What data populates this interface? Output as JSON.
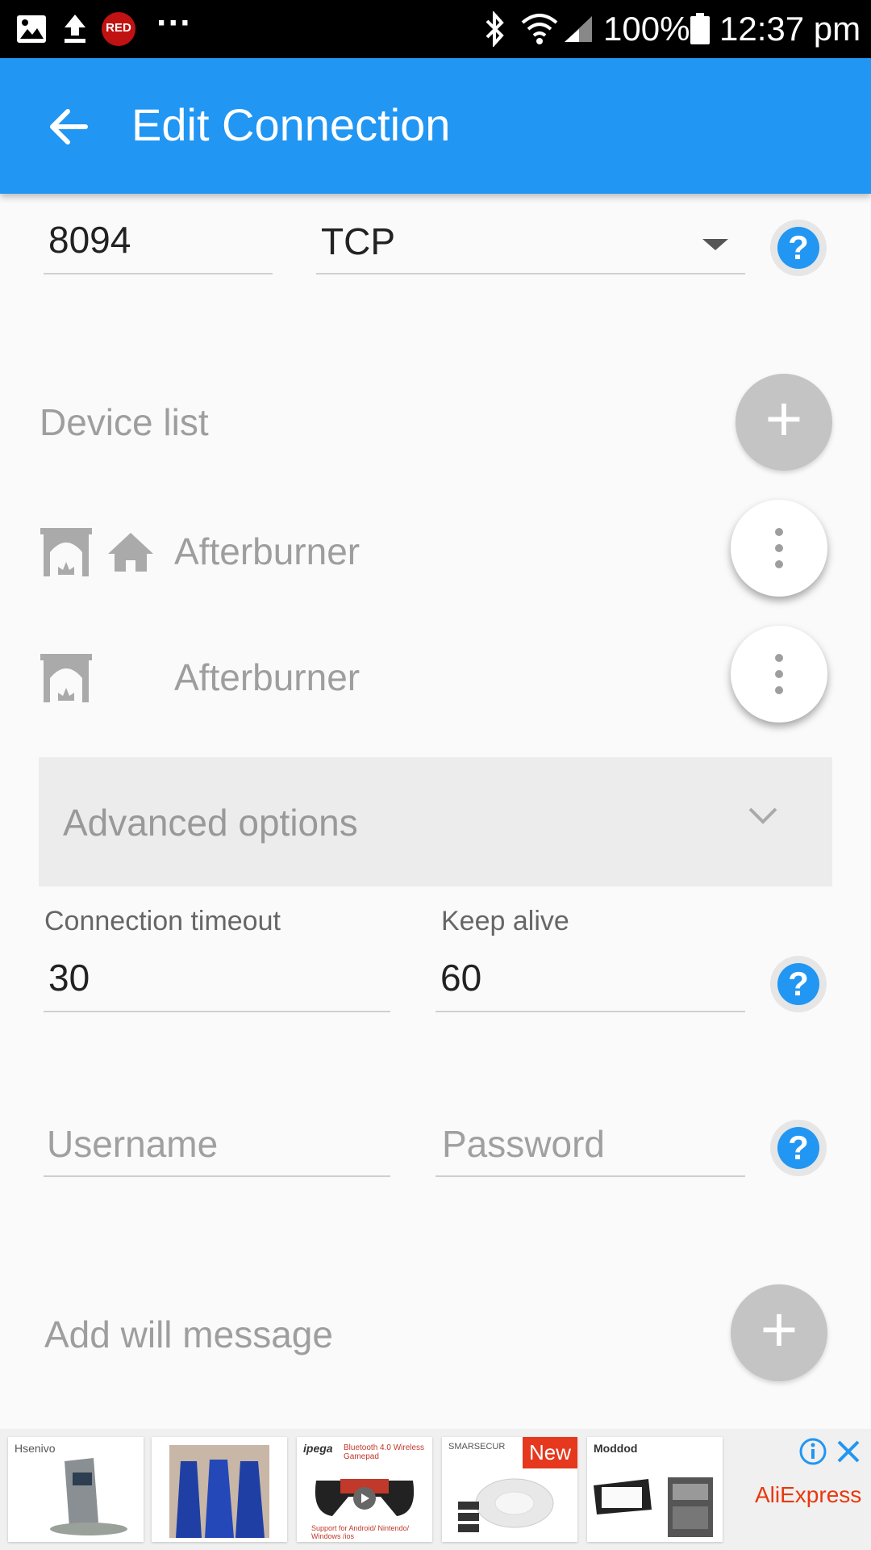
{
  "status_bar": {
    "notification_icons": [
      "image-icon",
      "upload-icon",
      "red-app-icon",
      "more-dots-icon"
    ],
    "red_badge": "RED",
    "dots": "···",
    "battery": "100%",
    "time": "12:37 pm",
    "system_icons": [
      "bluetooth-icon",
      "wifi-icon",
      "signal-icon",
      "battery-icon"
    ]
  },
  "app_bar": {
    "title": "Edit Connection",
    "back_icon": "arrow-left-icon"
  },
  "port": {
    "value": "8094"
  },
  "protocol": {
    "value": "TCP"
  },
  "device_list": {
    "title": "Device list",
    "devices": [
      {
        "name": "Afterburner",
        "icons": [
          "fireplace-icon",
          "home-icon"
        ]
      },
      {
        "name": "Afterburner",
        "icons": [
          "fireplace-icon"
        ]
      }
    ]
  },
  "advanced": {
    "title": "Advanced options"
  },
  "timeout": {
    "label": "Connection timeout",
    "value": "30"
  },
  "keep_alive": {
    "label": "Keep alive",
    "value": "60"
  },
  "credentials": {
    "username_placeholder": "Username",
    "password_placeholder": "Password"
  },
  "will": {
    "label": "Add will message"
  },
  "help_symbol": "?",
  "plus_symbol": "+",
  "ads": {
    "cards": [
      {
        "brand": "Hsenivo"
      },
      {
        "brand": ""
      },
      {
        "brand": "ipega",
        "text": "Bluetooth 4.0 Wireless Gamepad",
        "sub": "Support for Android/ Nintendo/ Windows /ios"
      },
      {
        "brand": "SMARSECUR",
        "badge": "New"
      },
      {
        "brand": "Moddod"
      }
    ],
    "provider": "AliExpress"
  },
  "colors": {
    "primary": "#2196f3",
    "status_bar": "#000000",
    "badge_red": "#e5381e"
  }
}
